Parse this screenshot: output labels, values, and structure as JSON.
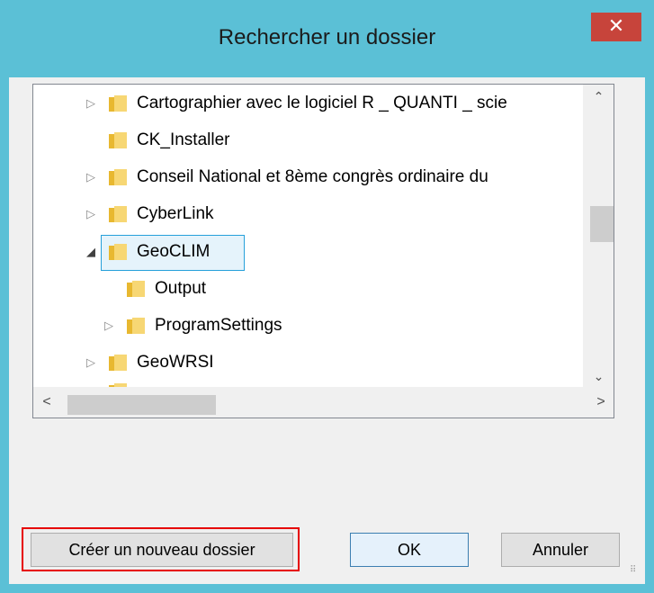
{
  "window": {
    "title": "Rechercher un dossier",
    "close_label": "✕"
  },
  "tree": {
    "items": [
      {
        "label": "Cartographier avec le logiciel R _ QUANTI _ scie",
        "expander": "▷",
        "level": 0
      },
      {
        "label": "CK_Installer",
        "expander": "",
        "level": 0
      },
      {
        "label": "Conseil National et 8ème congrès ordinaire du",
        "expander": "▷",
        "level": 0
      },
      {
        "label": "CyberLink",
        "expander": "▷",
        "level": 0
      },
      {
        "label": "GeoCLIM",
        "expander": "◢",
        "level": 0,
        "selected": true
      },
      {
        "label": "Output",
        "expander": "",
        "level": 1
      },
      {
        "label": "ProgramSettings",
        "expander": "▷",
        "level": 1
      },
      {
        "label": "GeoWRSI",
        "expander": "▷",
        "level": 0
      }
    ]
  },
  "scrollbars": {
    "up": "⌃",
    "down": "⌄",
    "left": "<",
    "right": ">"
  },
  "buttons": {
    "new_folder": "Créer un nouveau dossier",
    "ok": "OK",
    "cancel": "Annuler"
  },
  "colors": {
    "title_bar": "#5bc0d6",
    "close": "#c7443b",
    "highlight": "#e60000",
    "selection": "#e5f3fb"
  }
}
